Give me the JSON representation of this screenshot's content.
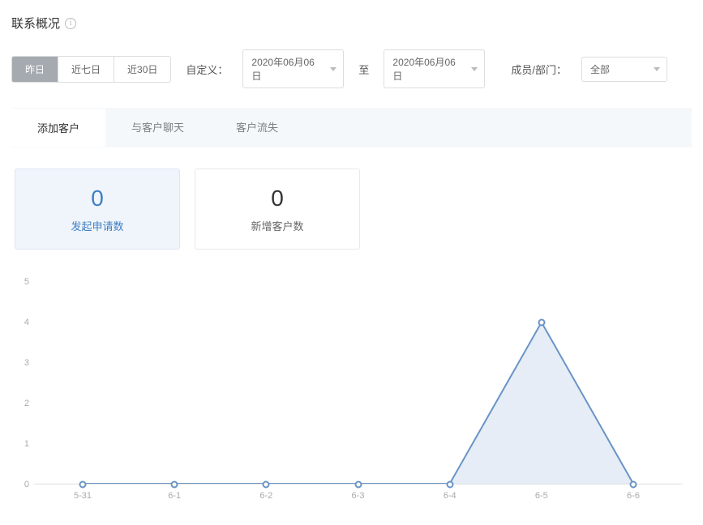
{
  "page_title": "联系概况",
  "range_buttons": {
    "yesterday": "昨日",
    "last7": "近七日",
    "last30": "近30日"
  },
  "custom_label": "自定义：",
  "date_from": "2020年06月06日",
  "date_sep": "至",
  "date_to": "2020年06月06日",
  "member_label": "成员/部门：",
  "member_selected": "全部",
  "tabs": {
    "add": "添加客户",
    "chat": "与客户聊天",
    "lost": "客户流失"
  },
  "stats": {
    "requests": {
      "value": "0",
      "label": "发起申请数"
    },
    "new_customers": {
      "value": "0",
      "label": "新增客户数"
    }
  },
  "chart_data": {
    "type": "line",
    "title": "",
    "xlabel": "",
    "ylabel": "",
    "ylim": [
      0,
      5
    ],
    "y_ticks": [
      0,
      1,
      2,
      3,
      4,
      5
    ],
    "categories": [
      "5-31",
      "6-1",
      "6-2",
      "6-3",
      "6-4",
      "6-5",
      "6-6"
    ],
    "values": [
      0,
      0,
      0,
      0,
      0,
      4,
      0
    ],
    "color": "#6a94c7",
    "fill": "#dbe6f2"
  }
}
